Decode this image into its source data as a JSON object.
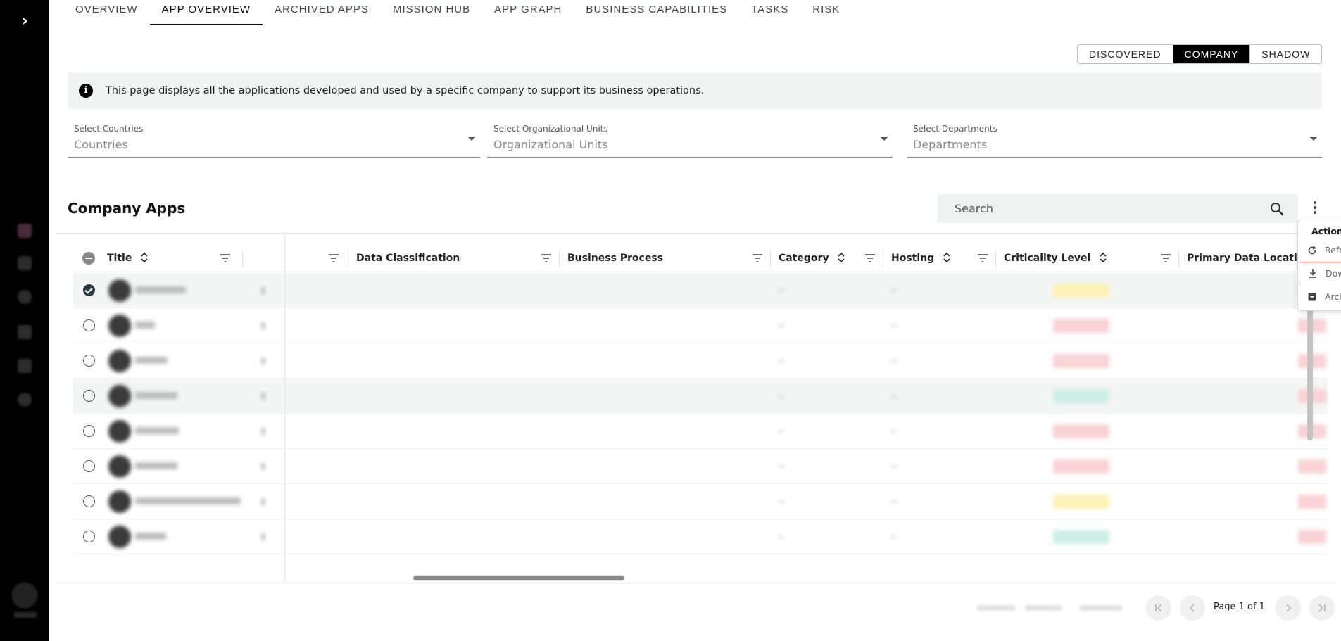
{
  "tabs": [
    {
      "label": "OVERVIEW"
    },
    {
      "label": "APP OVERVIEW"
    },
    {
      "label": "ARCHIVED APPS"
    },
    {
      "label": "MISSION HUB"
    },
    {
      "label": "APP GRAPH"
    },
    {
      "label": "BUSINESS CAPABILITIES"
    },
    {
      "label": "TASKS"
    },
    {
      "label": "RISK"
    }
  ],
  "active_tab": "APP OVERVIEW",
  "view_toggle": {
    "options": [
      "DISCOVERED",
      "COMPANY",
      "SHADOW"
    ],
    "selected": "COMPANY"
  },
  "info": {
    "text": "This page displays all the applications developed and used by a specific company to support its business operations."
  },
  "filters": [
    {
      "label": "Select Countries",
      "placeholder": "Countries"
    },
    {
      "label": "Select Organizational Units",
      "placeholder": "Organizational Units"
    },
    {
      "label": "Select Departments",
      "placeholder": "Departments"
    }
  ],
  "section": {
    "title": "Company Apps"
  },
  "search": {
    "placeholder": "Search"
  },
  "table": {
    "columns": [
      "Title",
      "Data Classification",
      "Business Process",
      "Category",
      "Hosting",
      "Criticality Level",
      "Primary Data Location"
    ],
    "rows": [
      {
        "selected": true,
        "criticality": "Medium"
      },
      {
        "selected": false,
        "criticality": "High"
      },
      {
        "selected": false,
        "criticality": "High"
      },
      {
        "selected": false,
        "criticality": "Low"
      },
      {
        "selected": false,
        "criticality": "High"
      },
      {
        "selected": false,
        "criticality": "High"
      },
      {
        "selected": false,
        "criticality": "Medium"
      },
      {
        "selected": false,
        "criticality": "Low"
      }
    ]
  },
  "pagination": {
    "label": "Page 1 of 1"
  },
  "actions_menu": {
    "title": "Actions",
    "items": [
      {
        "label": "Refresh",
        "icon": "refresh-icon"
      },
      {
        "label": "Download",
        "icon": "download-icon",
        "highlighted": true
      },
      {
        "label": "Archive",
        "icon": "archive-icon"
      }
    ]
  },
  "colors": {
    "accent": "#000000",
    "highlight_border": "#e53935",
    "medium": "#fbf2b5",
    "high": "#f8d2d4",
    "low": "#cdeee4"
  }
}
